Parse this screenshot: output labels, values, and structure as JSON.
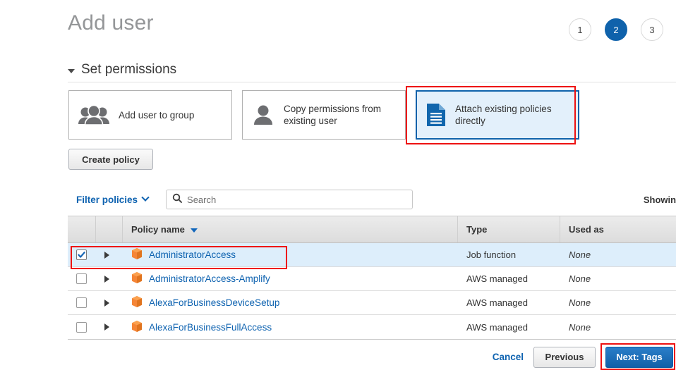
{
  "header": {
    "title": "Add user",
    "steps": [
      {
        "label": "1",
        "active": false
      },
      {
        "label": "2",
        "active": true
      },
      {
        "label": "3",
        "active": false
      }
    ]
  },
  "section": {
    "title": "Set permissions",
    "caret_icon": "caret-down-icon"
  },
  "permission_options": [
    {
      "label": "Add user to group",
      "icon": "users-group-icon",
      "selected": false
    },
    {
      "label": "Copy permissions from existing user",
      "icon": "user-icon",
      "selected": false
    },
    {
      "label": "Attach existing policies directly",
      "icon": "document-policy-icon",
      "selected": true
    }
  ],
  "toolbar": {
    "create_policy_label": "Create policy"
  },
  "filter": {
    "label": "Filter policies",
    "chevron_icon": "chevron-down-icon",
    "search_icon": "search-icon",
    "search_value": "",
    "search_placeholder": "Search",
    "showing_label": "Showing"
  },
  "table": {
    "columns": {
      "select": "",
      "expand": "",
      "name": "Policy name",
      "type": "Type",
      "used_as": "Used as"
    },
    "sort_icon": "sort-descending-icon",
    "rows": [
      {
        "checked": true,
        "name": "AdministratorAccess",
        "type": "Job function",
        "used_as": "None",
        "icon": "policy-cube-icon"
      },
      {
        "checked": false,
        "name": "AdministratorAccess-Amplify",
        "type": "AWS managed",
        "used_as": "None",
        "icon": "policy-cube-icon"
      },
      {
        "checked": false,
        "name": "AlexaForBusinessDeviceSetup",
        "type": "AWS managed",
        "used_as": "None",
        "icon": "policy-cube-icon"
      },
      {
        "checked": false,
        "name": "AlexaForBusinessFullAccess",
        "type": "AWS managed",
        "used_as": "None",
        "icon": "policy-cube-icon"
      }
    ]
  },
  "footer": {
    "cancel_label": "Cancel",
    "previous_label": "Previous",
    "next_label": "Next: Tags"
  },
  "colors": {
    "accent_blue": "#0f62ab",
    "link_blue": "#0d62b0",
    "selected_row_bg": "#ddeefb",
    "selected_card_bg": "#e3f0fb",
    "annotation_red": "#ee1111",
    "policy_icon_orange": "#f58536",
    "title_gray": "#949698"
  }
}
